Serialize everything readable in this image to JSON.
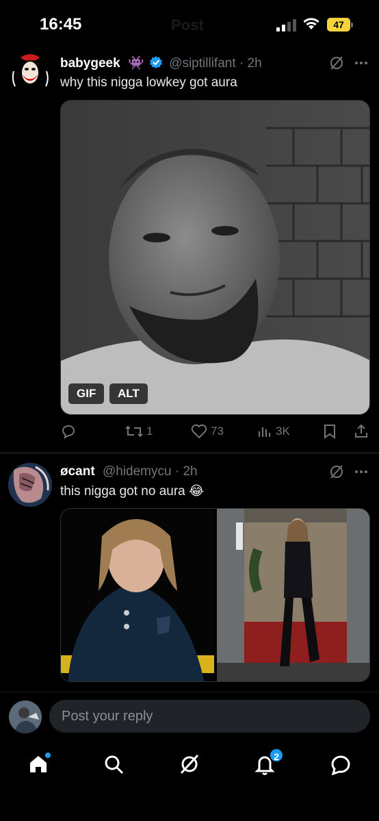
{
  "status_bar": {
    "time": "16:45",
    "header_title": "Post",
    "battery": "47"
  },
  "tweets": [
    {
      "name": "babygeek",
      "emoji": "👾",
      "handle": "@siptillifant",
      "age": "· 2h",
      "text": "why this nigga lowkey got aura",
      "media_tags": [
        "GIF",
        "ALT"
      ],
      "counts": {
        "reposts": "1",
        "likes": "73",
        "views": "3K"
      }
    },
    {
      "name": "øcant",
      "handle": "@hidemycu",
      "age": "· 2h",
      "text": "this nigga got no aura 😂"
    }
  ],
  "reply": {
    "placeholder": "Post your reply"
  },
  "nav": {
    "notifications_badge": "2"
  },
  "colors": {
    "accent": "#1d9bf0",
    "verified": "#1d9bf0",
    "muted": "#71767b",
    "battery": "#f4d33d"
  }
}
